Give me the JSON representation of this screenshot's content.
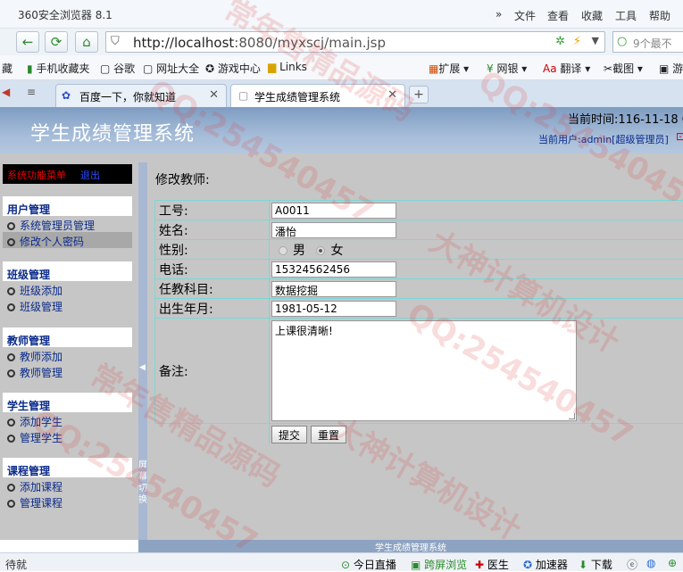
{
  "browser": {
    "title": "360安全浏览器 8.1",
    "menu": [
      "文件",
      "查看",
      "收藏",
      "工具",
      "帮助"
    ],
    "url_host": "http://localhost",
    "url_rest": ":8080/myxscj/main.jsp",
    "search_placeholder": "9个最不",
    "bookmarks": [
      "藏",
      "手机收藏夹",
      "谷歌",
      "网址大全",
      "游戏中心",
      "Links",
      "扩展",
      "网银",
      "翻译",
      "截图",
      "游"
    ],
    "tabs": [
      "百度一下，你就知道",
      "学生成绩管理系统"
    ]
  },
  "header": {
    "system_title": "学生成绩管理系统",
    "time": "当前时间:116-11-18 C",
    "user": "当前用户:admin[超级管理员]"
  },
  "sidebar": {
    "menu_title": "系统功能菜单",
    "logout": "退出",
    "groups": [
      {
        "title": "用户管理",
        "items": [
          "系统管理员管理",
          "修改个人密码"
        ]
      },
      {
        "title": "班级管理",
        "items": [
          "班级添加",
          "班级管理"
        ]
      },
      {
        "title": "教师管理",
        "items": [
          "教师添加",
          "教师管理"
        ]
      },
      {
        "title": "学生管理",
        "items": [
          "添加学生",
          "管理学生"
        ]
      },
      {
        "title": "课程管理",
        "items": [
          "添加课程",
          "管理课程"
        ]
      }
    ],
    "splitter_label": "屏幕切换"
  },
  "form": {
    "title": "修改教师:",
    "labels": {
      "id": "工号:",
      "name": "姓名:",
      "gender": "性别:",
      "phone": "电话:",
      "subject": "任教科目:",
      "birth": "出生年月:",
      "note": "备注:"
    },
    "values": {
      "id": "A0011",
      "name": "潘怡",
      "phone": "15324562456",
      "subject": "数据挖掘",
      "birth": "1981-05-12",
      "note": "上课很清晰!"
    },
    "gender_options": [
      "男",
      "女"
    ],
    "gender_selected": "女",
    "submit": "提交",
    "reset": "重置"
  },
  "footer": "学生成绩管理系统",
  "status": {
    "left": "待就",
    "items": [
      "今日直播",
      "跨屏浏览",
      "医生",
      "加速器",
      "下载"
    ]
  },
  "watermarks": [
    "QQ:254540457",
    "大神计算机设计",
    "常年售精品源码"
  ]
}
